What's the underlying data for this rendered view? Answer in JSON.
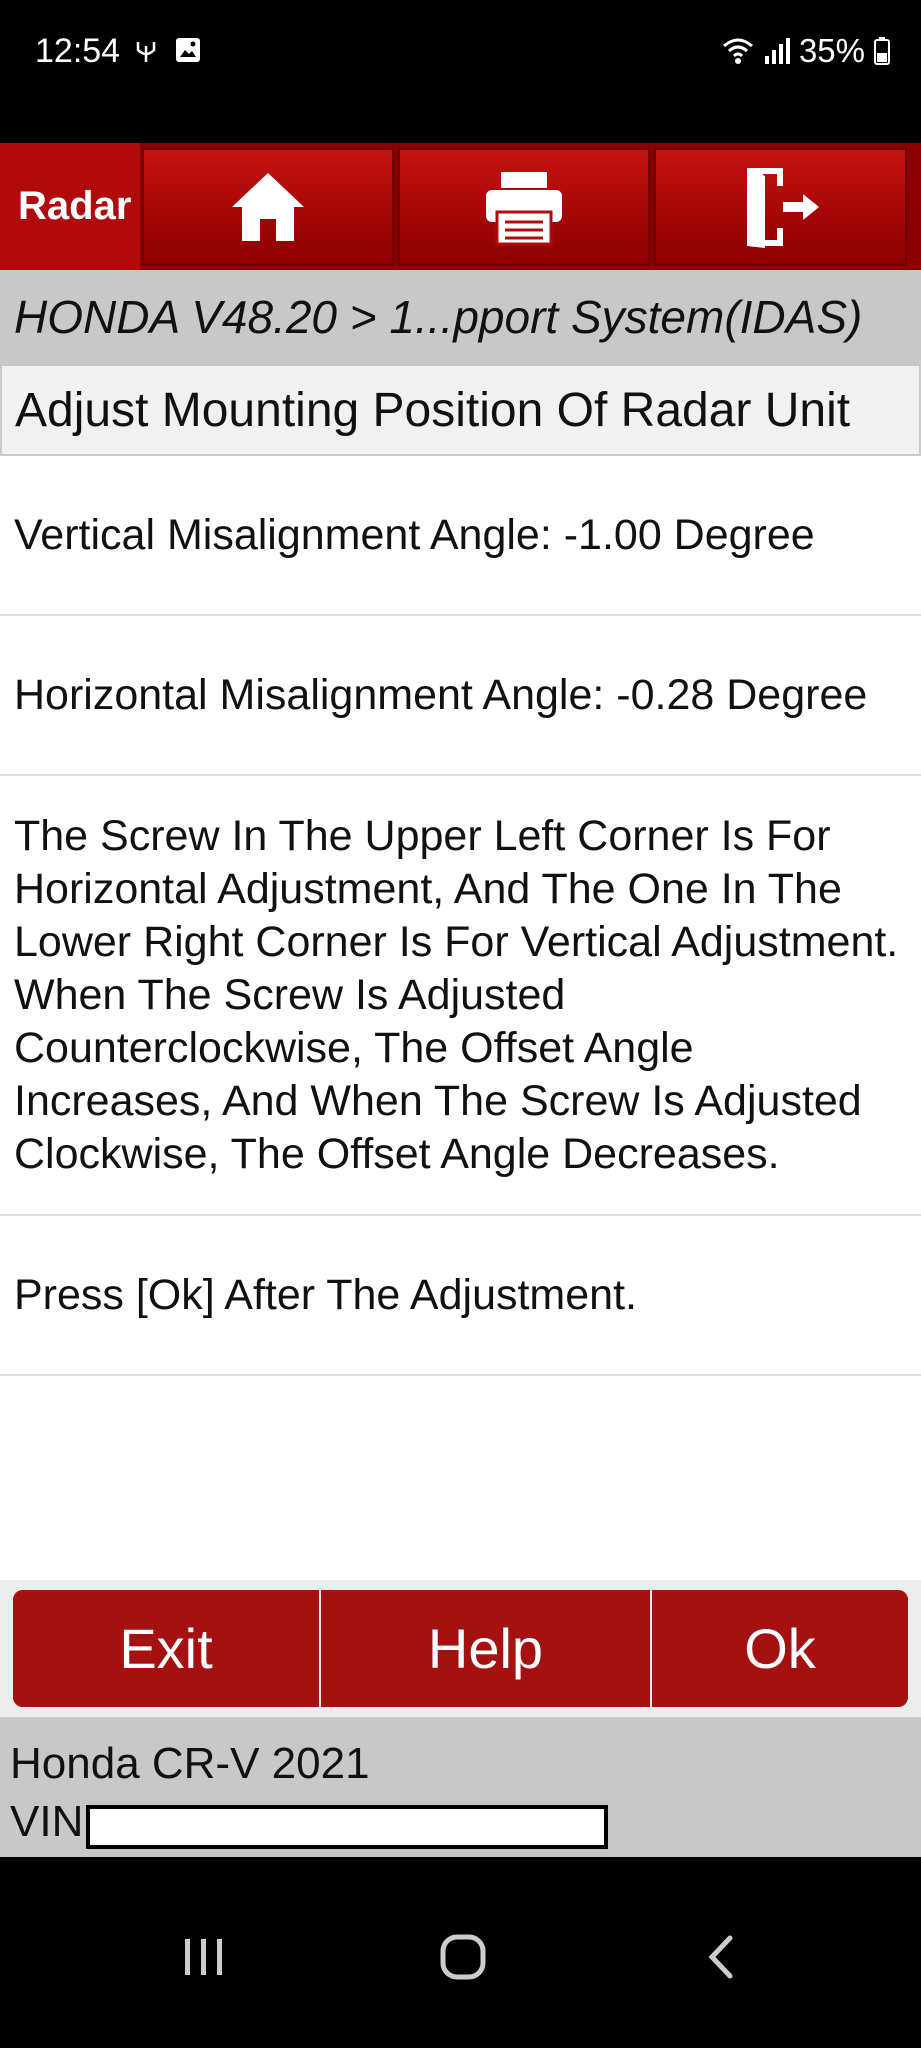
{
  "status_bar": {
    "time": "12:54",
    "battery": "35%",
    "icons": [
      "usb-debug-icon",
      "gallery-icon",
      "wifi-icon",
      "signal-icon",
      "battery-icon"
    ]
  },
  "toolbar": {
    "title": "Radar",
    "buttons": [
      "home-icon",
      "print-icon",
      "exit-door-icon"
    ]
  },
  "breadcrumb": "HONDA V48.20 > 1...pport System(IDAS)",
  "page_title": "Adjust Mounting Position Of Radar Unit",
  "content": {
    "vertical_angle": "Vertical Misalignment Angle: -1.00 Degree",
    "horizontal_angle": "Horizontal Misalignment Angle: -0.28 Degree",
    "instructions": "The Screw In The Upper Left Corner Is For Horizontal Adjustment, And The One In The Lower Right Corner Is For Vertical Adjustment. When The Screw Is Adjusted Counterclockwise, The Offset Angle Increases, And When The Screw Is Adjusted Clockwise, The Offset Angle Decreases.",
    "press_ok": "Press [Ok] After The Adjustment."
  },
  "actions": {
    "exit": "Exit",
    "help": "Help",
    "ok": "Ok"
  },
  "footer": {
    "vehicle": "Honda CR-V 2021",
    "vin_label": "VIN",
    "vin_value": ""
  },
  "colors": {
    "toolbar_red": "#b00a0a",
    "button_red": "#a51010",
    "breadcrumb_gray": "#c8c8c8"
  }
}
